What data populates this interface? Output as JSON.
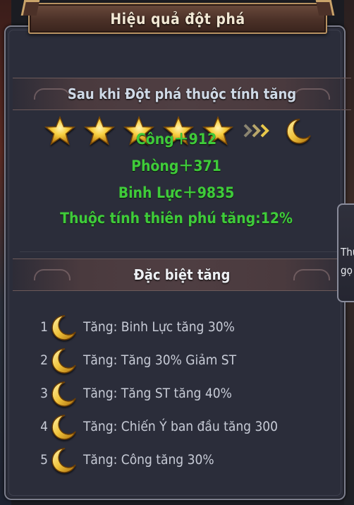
{
  "panel": {
    "title": "Hiệu quả đột phá"
  },
  "breakthrough": {
    "header": "Sau khi Đột phá thuộc tính tăng",
    "stars_before": 5,
    "stats": [
      "Công＋912",
      "Phòng＋371",
      "Binh Lực＋9835",
      "Thuộc tính thiên phú tăng:12%"
    ]
  },
  "special": {
    "header": "Đặc biệt tăng",
    "items": [
      {
        "num": "1",
        "text": "Tăng:  Binh Lực tăng 30%"
      },
      {
        "num": "2",
        "text": "Tăng:  Tăng 30% Giảm ST"
      },
      {
        "num": "3",
        "text": "Tăng:  Tăng ST tăng 40%"
      },
      {
        "num": "4",
        "text": "Tăng:  Chiến Ý ban đầu tăng 300"
      },
      {
        "num": "5",
        "text": "Tăng:  Công tăng 30%"
      }
    ]
  },
  "side_tab": {
    "line1": "Thu",
    "line2": "gọ"
  },
  "colors": {
    "stat_green": "#3fcb3a",
    "star_gold": "#f3c23a",
    "moon_gold": "#f0c33c"
  },
  "icons": [
    "star-icon",
    "arrow-right-icon",
    "moon-icon"
  ]
}
